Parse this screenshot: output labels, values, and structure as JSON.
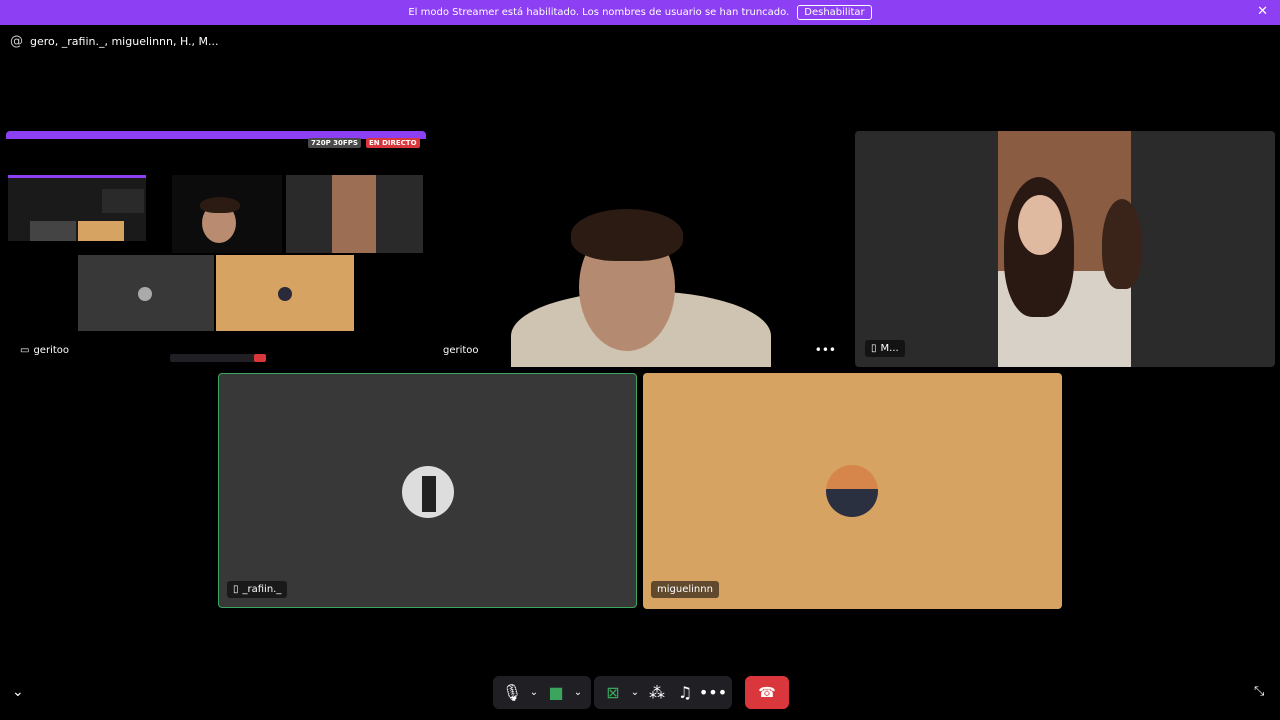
{
  "banner": {
    "text": "El modo Streamer está habilitado. Los nombres de usuario se han truncado.",
    "button": "Deshabilitar"
  },
  "header": {
    "title": "gero, _rafiin._, miguelinnn, H., M..."
  },
  "stream_preview": {
    "quality": "720P 30FPS",
    "live": "EN DIRECTO",
    "owner": "geritoo"
  },
  "tiles": [
    {
      "name": "geritoo"
    },
    {
      "name": "M..."
    },
    {
      "name": "_rafiin._"
    },
    {
      "name": "miguelinnn"
    }
  ],
  "colors": {
    "banner": "#8c3ff3",
    "speaking_border": "#3ba55d",
    "tile_gray": "#383838",
    "tile_tan": "#d6a362",
    "end_call": "#da373c"
  }
}
